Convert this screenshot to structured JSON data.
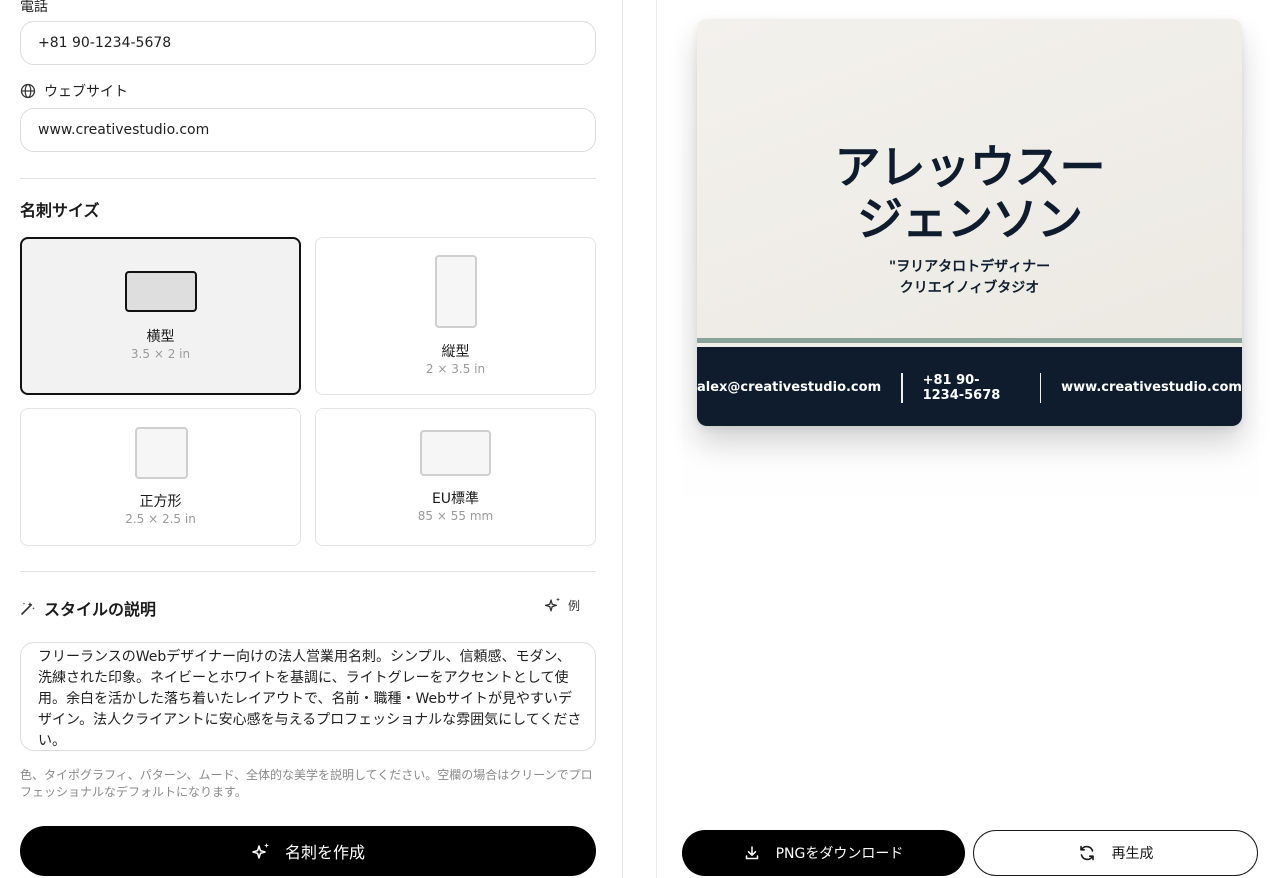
{
  "form": {
    "phone": {
      "label": "電話",
      "value": "+81 90-1234-5678"
    },
    "website": {
      "label": "ウェブサイト",
      "value": "www.creativestudio.com"
    },
    "size_section": {
      "title": "名刺サイズ",
      "options": [
        {
          "name": "横型",
          "dim": "3.5 × 2 in",
          "selected": true
        },
        {
          "name": "縦型",
          "dim": "2 × 3.5 in",
          "selected": false
        },
        {
          "name": "正方形",
          "dim": "2.5 × 2.5 in",
          "selected": false
        },
        {
          "name": "EU標準",
          "dim": "85 × 55 mm",
          "selected": false
        }
      ]
    },
    "style_section": {
      "title": "スタイルの説明",
      "example_label": "例",
      "description": "フリーランスのWebデザイナー向けの法人営業用名刺。シンプル、信頼感、モダン、洗練された印象。ネイビーとホワイトを基調に、ライトグレーをアクセントとして使用。余白を活かした落ち着いたレイアウトで、名前・職種・Webサイトが見やすいデザイン。法人クライアントに安心感を与えるプロフェッショナルな雰囲気にしてください。",
      "hint": "色、タイポグラフィ、パターン、ムード、全体的な美学を説明してください。空欄の場合はクリーンでプロフェッショナルなデフォルトになります。"
    },
    "create_button": "名刺を作成"
  },
  "preview": {
    "name_line1": "アレッウスー",
    "name_line2": "ジェンソン",
    "role_line1": "\"ヲリアタロトデザィナー",
    "role_line2": "クリエイノィブタジオ",
    "email": "alex@creativestudio.com",
    "phone": "+81 90-1234-5678",
    "website": "www.creativestudio.com"
  },
  "actions": {
    "download": "PNGをダウンロード",
    "regenerate": "再生成"
  },
  "colors": {
    "navy": "#0e1c2d",
    "accent_stripe": "#8aa39b",
    "card_bg": "#efece6"
  }
}
